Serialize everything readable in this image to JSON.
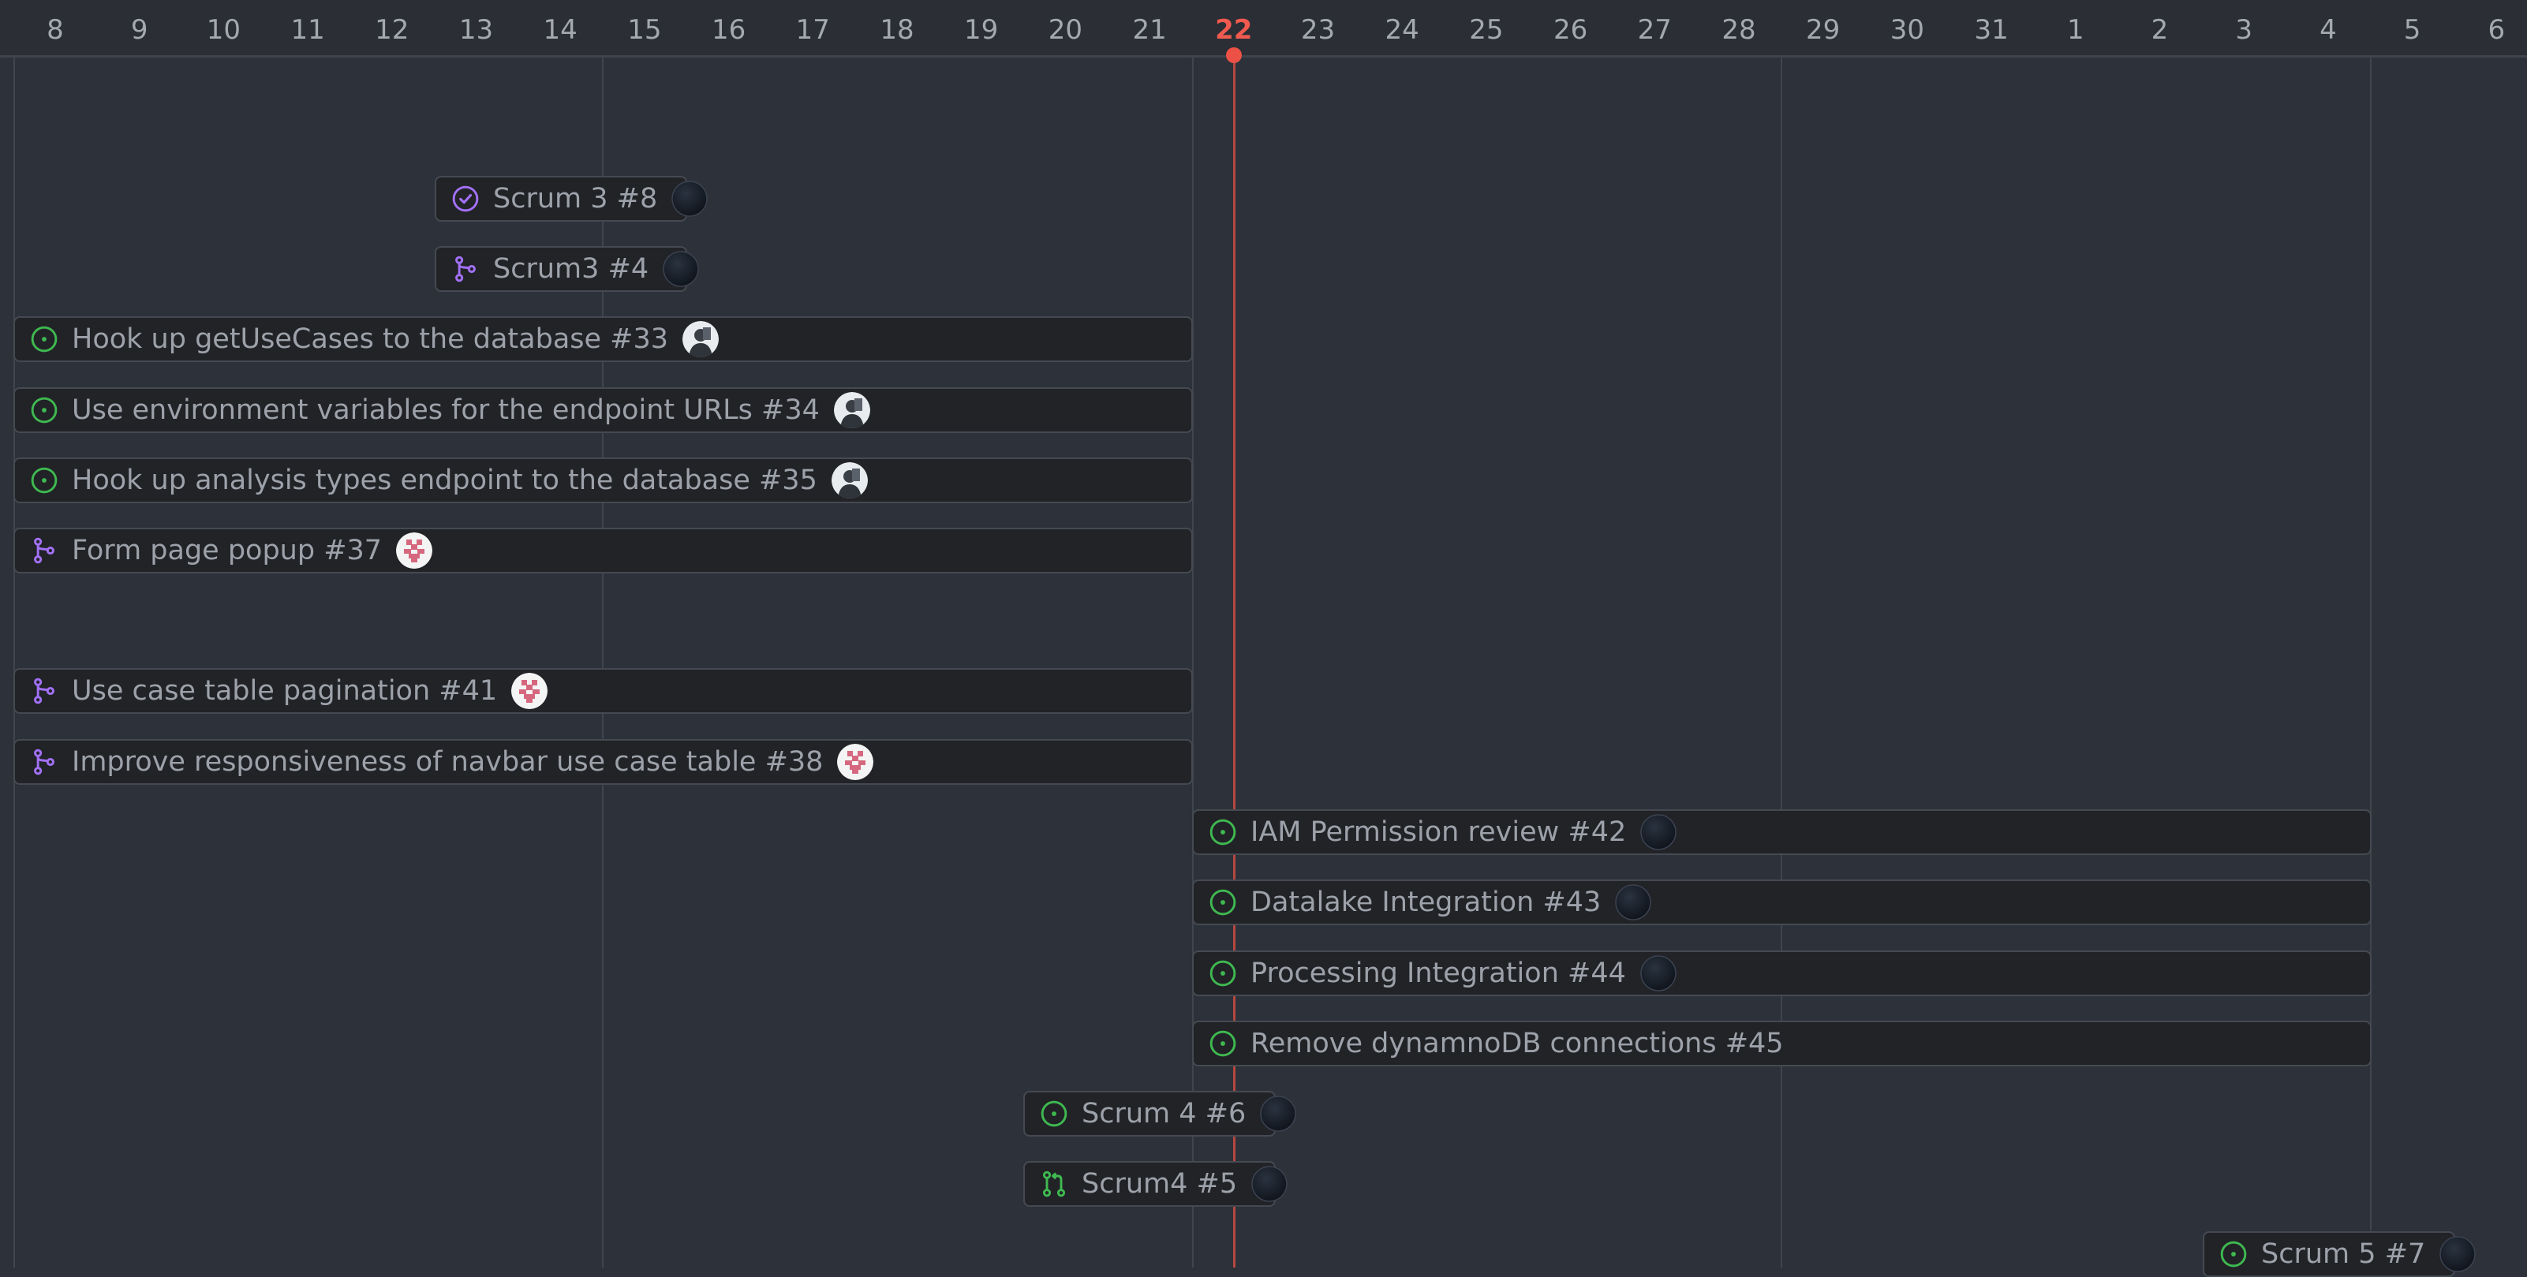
{
  "timeline": {
    "days": [
      "8",
      "9",
      "10",
      "11",
      "12",
      "13",
      "14",
      "15",
      "16",
      "17",
      "18",
      "19",
      "20",
      "21",
      "22",
      "23",
      "24",
      "25",
      "26",
      "27",
      "28",
      "29",
      "30",
      "31",
      "1",
      "2",
      "3",
      "4",
      "5",
      "6"
    ],
    "today": "22"
  },
  "items": [
    {
      "title": "Scrum 3 #8",
      "icon": "closed-check-icon",
      "avatar": "dark-avatar"
    },
    {
      "title": "Scrum3 #4",
      "icon": "branch-icon",
      "avatar": "dark-avatar"
    },
    {
      "title": "Hook up getUseCases to the database #33",
      "icon": "open-issue-icon",
      "avatar": "photo-avatar"
    },
    {
      "title": "Use environment variables for the endpoint URLs #34",
      "icon": "open-issue-icon",
      "avatar": "photo-avatar"
    },
    {
      "title": "Hook up analysis types endpoint to the database #35",
      "icon": "open-issue-icon",
      "avatar": "photo-avatar"
    },
    {
      "title": "Form page popup #37",
      "icon": "branch-icon",
      "avatar": "identicon-avatar"
    },
    {
      "title": "Use case table pagination #41",
      "icon": "branch-icon",
      "avatar": "identicon-avatar"
    },
    {
      "title": "Improve responsiveness of navbar use case table #38",
      "icon": "branch-icon",
      "avatar": "identicon-avatar"
    },
    {
      "title": "IAM Permission review #42",
      "icon": "open-issue-icon",
      "avatar": "dark-avatar"
    },
    {
      "title": "Datalake Integration #43",
      "icon": "open-issue-icon",
      "avatar": "dark-avatar"
    },
    {
      "title": "Processing Integration #44",
      "icon": "open-issue-icon",
      "avatar": "dark-avatar"
    },
    {
      "title": "Remove dynamnoDB connections #45",
      "icon": "open-issue-icon",
      "avatar": "none"
    },
    {
      "title": "Scrum 4 #6",
      "icon": "open-issue-icon",
      "avatar": "dark-avatar"
    },
    {
      "title": "Scrum4 #5",
      "icon": "pull-request-icon",
      "avatar": "dark-avatar"
    },
    {
      "title": "Scrum 5 #7",
      "icon": "open-issue-icon",
      "avatar": "dark-avatar"
    }
  ],
  "colors": {
    "open": "#3fb950",
    "purple": "#a371f7",
    "today": "#f05a4f"
  }
}
